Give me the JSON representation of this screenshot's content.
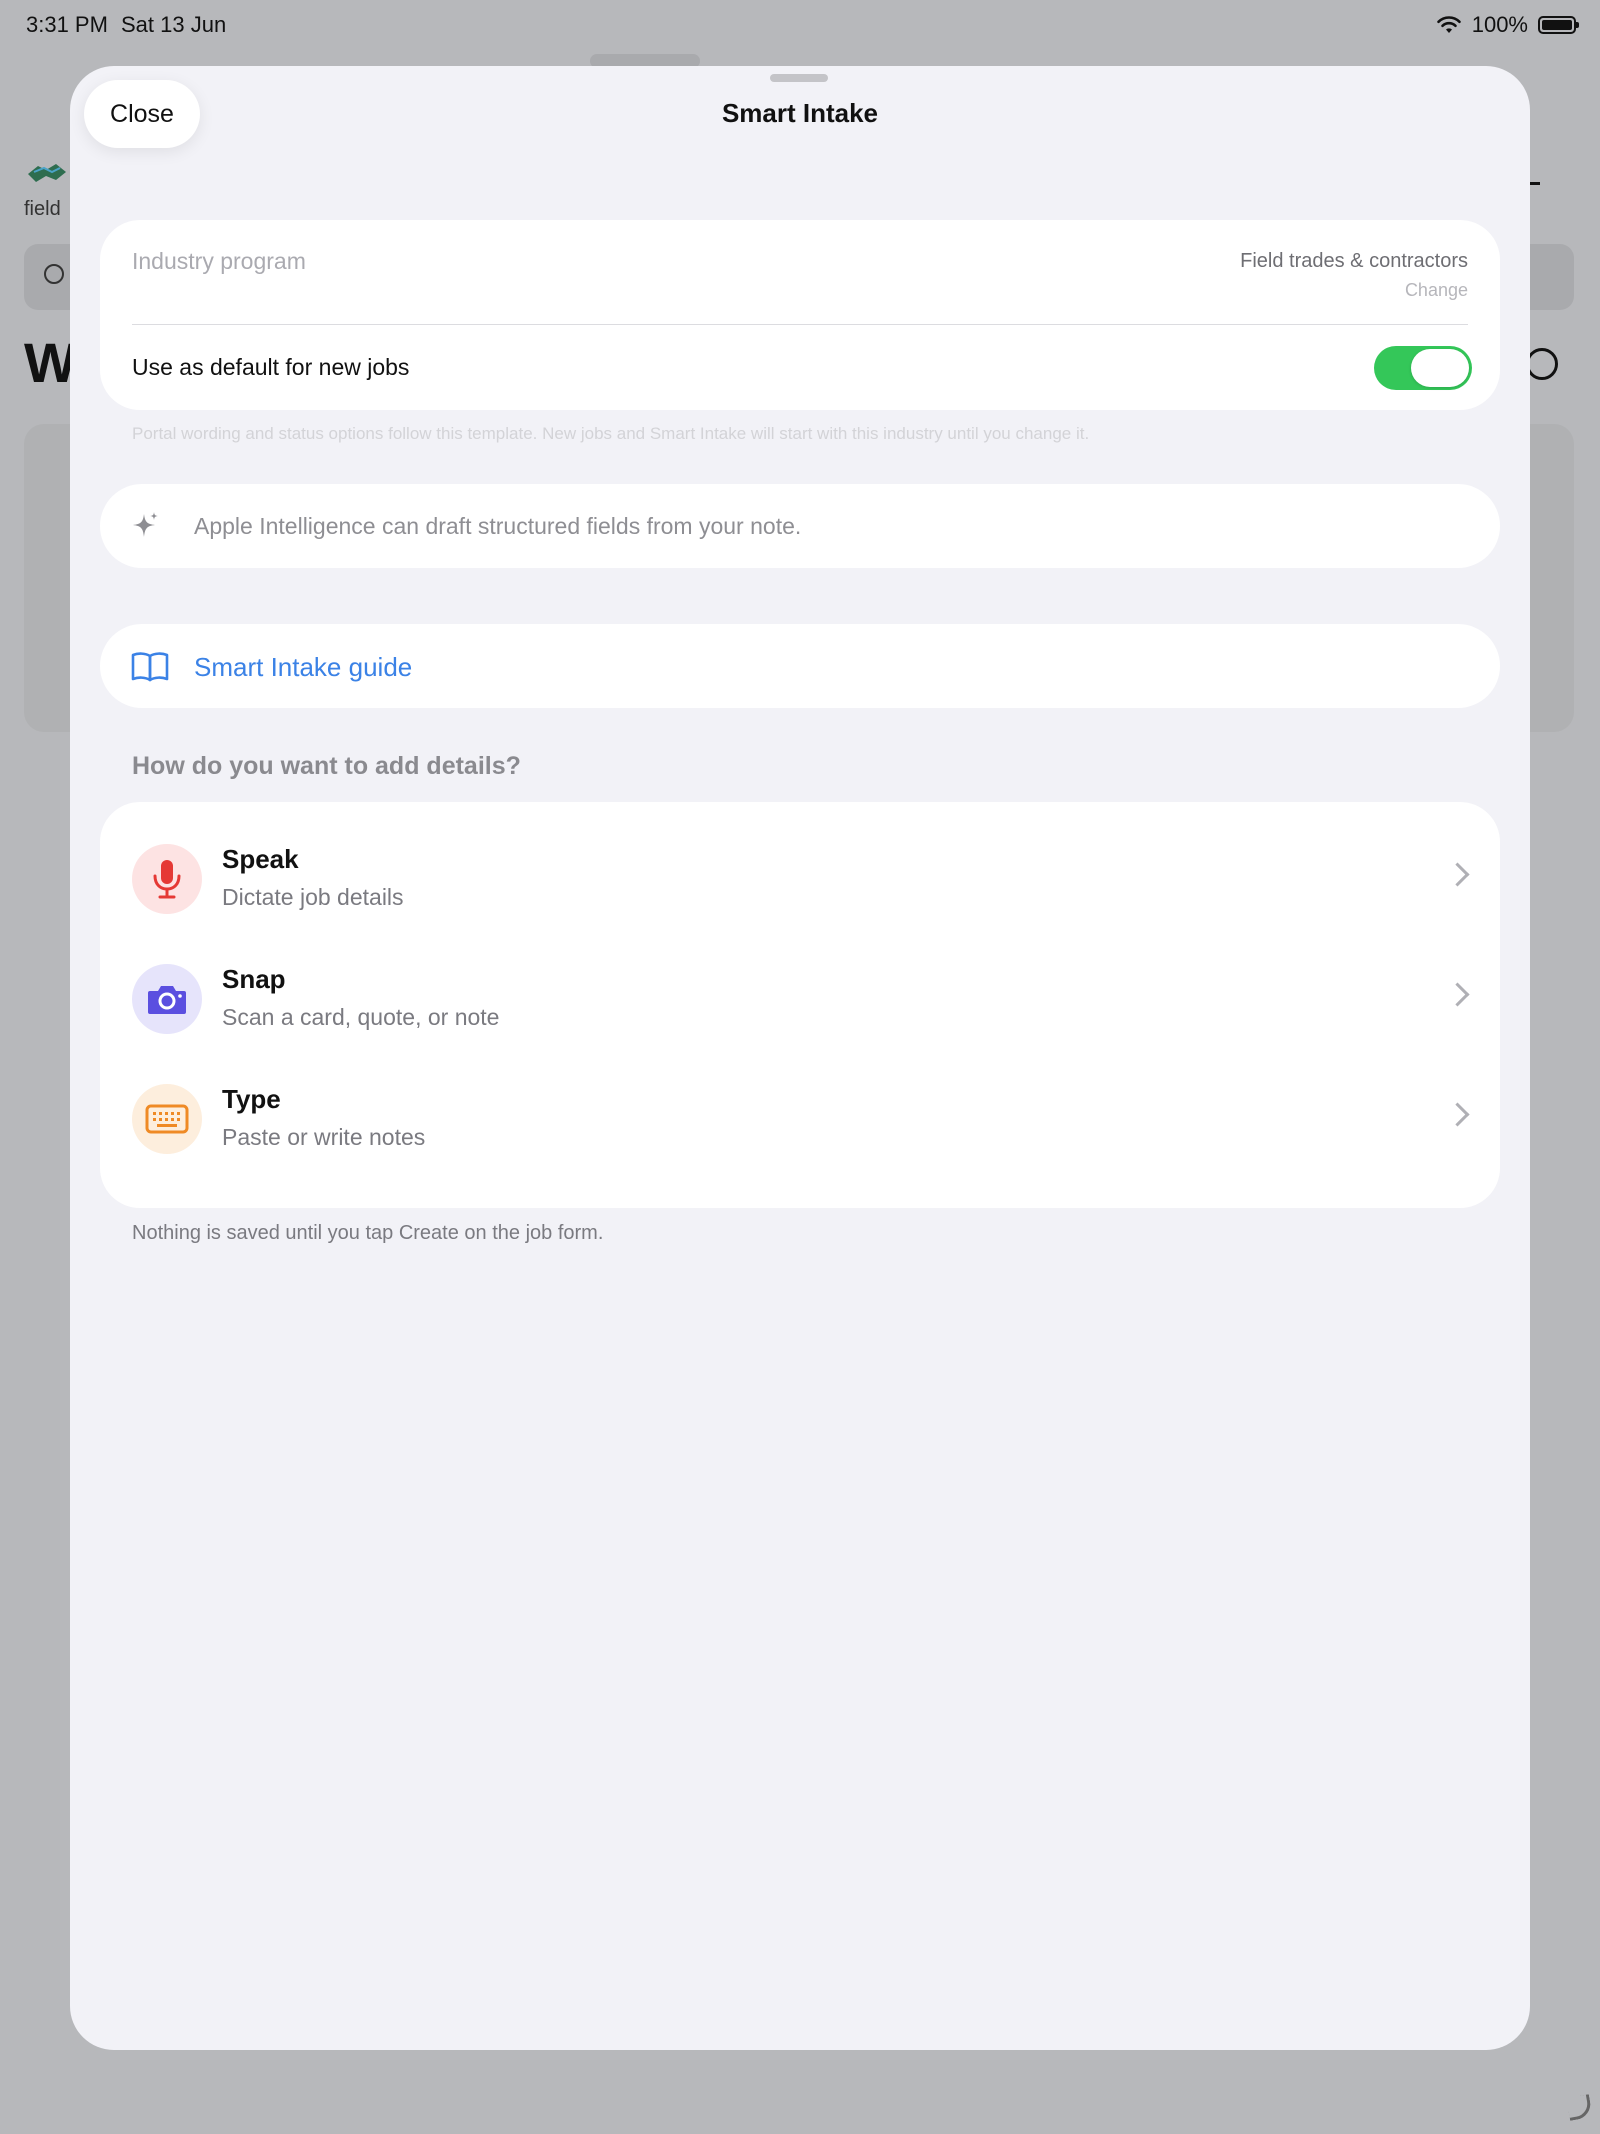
{
  "status_bar": {
    "time": "3:31 PM",
    "date": "Sat 13 Jun",
    "battery": "100%",
    "battery_level": 1.0,
    "icons": [
      "wifi-icon",
      "battery-icon"
    ]
  },
  "background": {
    "app_label_fragment": "field",
    "heading_fragment": "W"
  },
  "sheet": {
    "close_label": "Close",
    "title": "Smart Intake"
  },
  "industry": {
    "label": "Industry program",
    "value": "Field trades & contractors",
    "change_label": "Change",
    "default_toggle_label": "Use as default for new jobs",
    "default_toggle_on": true,
    "footnote": "Portal wording and status options follow this template. New jobs and Smart Intake will start with this industry until you change it."
  },
  "ai_note": {
    "icon": "sparkle-icon",
    "text": "Apple Intelligence can draft structured fields from your note."
  },
  "guide": {
    "icon": "book-icon",
    "label": "Smart Intake guide"
  },
  "options_section": {
    "header": "How do you want to add details?",
    "items": [
      {
        "title": "Speak",
        "subtitle": "Dictate job details",
        "icon": "microphone-icon",
        "color": "#e53935",
        "bg": "#fde3e3"
      },
      {
        "title": "Snap",
        "subtitle": "Scan a card, quote, or note",
        "icon": "camera-icon",
        "color": "#5b4fe0",
        "bg": "#e6e4fb"
      },
      {
        "title": "Type",
        "subtitle": "Paste or write notes",
        "icon": "keyboard-icon",
        "color": "#ef8a25",
        "bg": "#fdeedd"
      }
    ],
    "footnote": "Nothing is saved until you tap Create on the job form."
  },
  "colors": {
    "accent_blue": "#3b82e6",
    "toggle_green": "#34c759",
    "sheet_bg": "#f2f2f7"
  }
}
